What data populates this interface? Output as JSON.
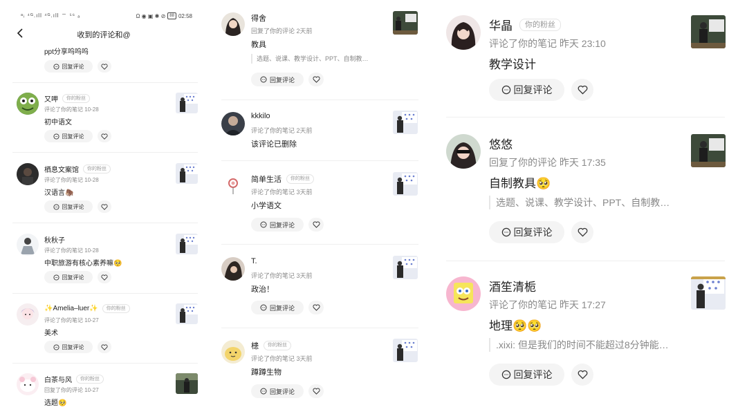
{
  "status_bar": {
    "left_text": "ᵃᵢ ⁴ᴳ.ıll ⁴ᴳ.ıll ⌔  ⁵⁶ ₐ",
    "right_icons": "Ω ◉ ▣ ✱ ⊘",
    "battery": "88",
    "time": "02:58"
  },
  "nav": {
    "title": "收到的评论和@"
  },
  "labels": {
    "reply": "回复评论",
    "fan": "你的粉丝"
  },
  "panel1": {
    "top_partial": {
      "content": "ppt分享呜呜呜"
    },
    "items": [
      {
        "name": "又呷",
        "fan": true,
        "meta": "评论了你的笔记  10-28",
        "content": "初中语文"
      },
      {
        "name": "栖息文案馆",
        "fan": true,
        "meta": "评论了你的笔记  10-28",
        "content": "汉语言🦣"
      },
      {
        "name": "秋秋子",
        "fan": false,
        "meta": "评论了你的笔记  10-28",
        "content": "中职旅游有核心素养嘛🥺"
      },
      {
        "name": "✨Amelia–luer✨",
        "fan": true,
        "meta": "评论了你的笔记  10-27",
        "content": "美术"
      },
      {
        "name": "白茶与风",
        "fan": true,
        "meta": "回复了你的评论  10-27",
        "content": "选题🥺"
      }
    ]
  },
  "panel2": {
    "items": [
      {
        "name": "得舍",
        "fan": false,
        "meta": "回复了你的评论  2天前",
        "content": "教具",
        "quote": "选题、说课、教学设计、PPT、自制教…"
      },
      {
        "name": "kkkilo",
        "fan": false,
        "meta": "评论了你的笔记  2天前",
        "content": "该评论已删除"
      },
      {
        "name": "简单生活",
        "fan": true,
        "meta": "评论了你的笔记  3天前",
        "content": "小学语文"
      },
      {
        "name": "T.",
        "fan": false,
        "meta": "评论了你的笔记  3天前",
        "content": "政治！"
      },
      {
        "name": "槵",
        "fan": true,
        "meta": "评论了你的笔记  3天前",
        "content": "蹲蹲生物"
      }
    ]
  },
  "panel3": {
    "items": [
      {
        "name": "华晶",
        "fan": true,
        "meta": "评论了你的笔记  昨天 23:10",
        "content": "教学设计"
      },
      {
        "name": "悠悠",
        "fan": false,
        "meta": "回复了你的评论  昨天 17:35",
        "content": "自制教具🥺",
        "quote": "选题、说课、教学设计、PPT、自制教…"
      },
      {
        "name": "酒笙清栀",
        "fan": false,
        "meta": "评论了你的笔记  昨天 17:27",
        "content": "地理🥺🥺",
        "quote": ".xixi: 但是我们的时间不能超过8分钟能…"
      }
    ]
  },
  "colors": {
    "accent_text": "#222222",
    "meta_text": "#8a8a8a",
    "button_bg": "#f4f4f4"
  }
}
